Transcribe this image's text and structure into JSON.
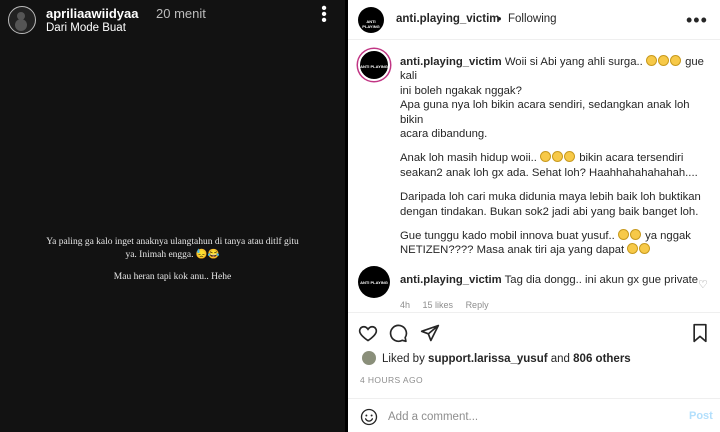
{
  "story": {
    "username": "apriliaawiidyaa",
    "time": "20 menit",
    "subtitle": "Dari Mode Buat",
    "text_line1": "Ya paling ga kalo inget anaknya ulangtahun di tanya atau ditlf gitu",
    "text_line2": "ya. Inimah engga.",
    "text_line3": "Mau heran tapi kok anu.. Hehe",
    "emoji": "😓😂"
  },
  "post": {
    "username": "anti.playing_victim",
    "separator": "•",
    "follow_label": "Following",
    "avatar_logo_text": "ANTI PLAYING",
    "caption": {
      "username": "anti.playing_victim",
      "line1": "Woii si Abi yang ahli surga..",
      "line1_end": "gue kali",
      "line2": "ini boleh ngakak nggak?",
      "line3": "Apa guna nya loh bikin acara sendiri, sedangkan anak loh bikin",
      "line4": "acara dibandung.",
      "line5": "Anak loh masih hidup woii..",
      "line5_end": "bikin acara tersendiri",
      "line6": "seakan2 anak loh gx ada. Sehat loh? Haahhahahahahah....",
      "line7": "Daripada loh cari muka didunia maya lebih baik loh buktikan",
      "line8": "dengan tindakan. Bukan sok2 jadi abi yang baik banget loh.",
      "line9": "Gue tunggu kado mobil innova buat yusuf..",
      "line9_end": "ya nggak",
      "line10": "NETIZEN???? Masa anak tiri aja yang dapat"
    },
    "reply": {
      "username": "anti.playing_victim",
      "text": "Tag dia dongg.. ini akun gx gue private",
      "time": "4h",
      "likes": "15 likes",
      "reply_label": "Reply"
    },
    "likes_prefix": "Liked by",
    "likes_user": "support.larissa_yusuf",
    "likes_and": "and",
    "likes_others": "806 others",
    "date": "4 HOURS AGO",
    "comment_placeholder": "Add a comment...",
    "post_label": "Post"
  }
}
